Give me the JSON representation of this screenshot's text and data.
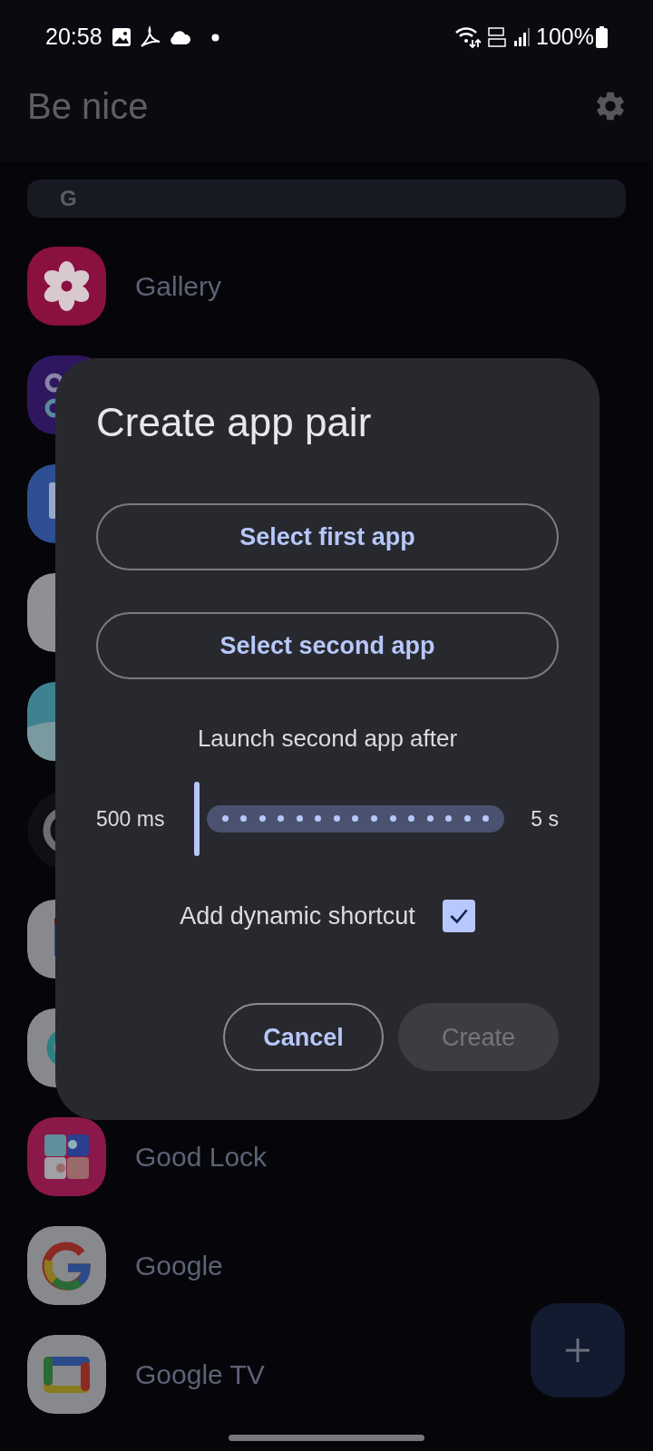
{
  "status_bar": {
    "time": "20:58",
    "battery": "100%"
  },
  "app_bar": {
    "title": "Be nice"
  },
  "section_header": {
    "letter": "G"
  },
  "apps": [
    {
      "kind": "gallery",
      "name": "Gallery"
    },
    {
      "kind": "purple"
    },
    {
      "kind": "blue"
    },
    {
      "kind": "grey"
    },
    {
      "kind": "teal"
    },
    {
      "kind": "dark"
    },
    {
      "kind": "mail"
    },
    {
      "kind": "ring"
    },
    {
      "kind": "goodlock",
      "name": "Good Lock"
    },
    {
      "kind": "google",
      "name": "Google"
    },
    {
      "kind": "tv",
      "name": "Google TV"
    }
  ],
  "dialog": {
    "title": "Create app pair",
    "select_buttons": [
      "Select first app",
      "Select second app"
    ],
    "delay": {
      "label": "Launch second app after",
      "min": "500 ms",
      "max": "5 s",
      "level": 0
    },
    "shortcut": {
      "label": "Add dynamic shortcut",
      "checked": true
    },
    "actions": [
      {
        "label": "Cancel",
        "disabled": false
      },
      {
        "label": "Create",
        "disabled": true
      }
    ]
  }
}
